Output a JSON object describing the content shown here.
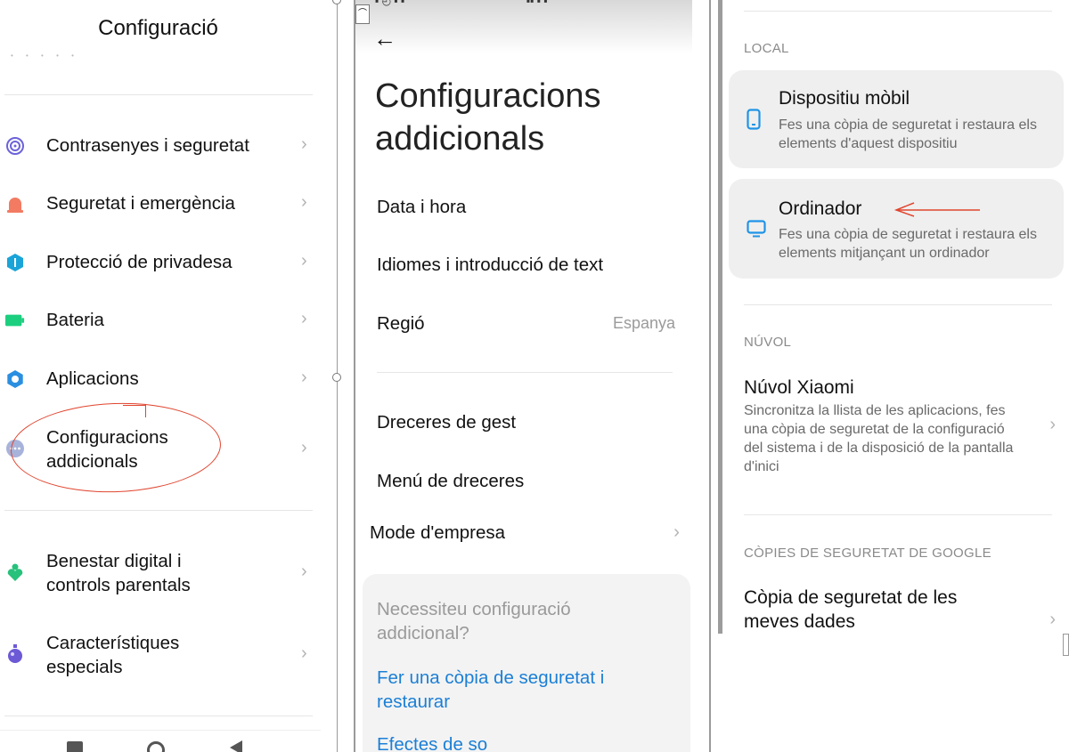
{
  "panel1": {
    "title": "Configuració",
    "items": [
      {
        "label": "Contrasenyes i seguretat",
        "icon": "fingerprint-icon",
        "color": "#6b63d9"
      },
      {
        "label": "Seguretat i emergència",
        "icon": "alarm-icon",
        "color": "#f27b62"
      },
      {
        "label": "Protecció de privadesa",
        "icon": "privacy-shield-icon",
        "color": "#1aa4d8"
      },
      {
        "label": "Bateria",
        "icon": "battery-icon",
        "color": "#1ccf7f"
      },
      {
        "label": "Aplicacions",
        "icon": "gear-icon",
        "color": "#2a8fe0"
      },
      {
        "label": "Configuracions addicionals",
        "icon": "more-dots-icon",
        "color": "#a7b3da"
      },
      {
        "label": "Benestar digital i controls parentals",
        "icon": "wellbeing-icon",
        "color": "#27c17b"
      },
      {
        "label": "Característiques especials",
        "icon": "special-features-icon",
        "color": "#6c59d6"
      }
    ]
  },
  "panel2": {
    "title": "Configuracions addicionals",
    "items": [
      {
        "label": "Data i hora",
        "value": ""
      },
      {
        "label": "Idiomes i introducció de text",
        "value": ""
      },
      {
        "label": "Regió",
        "value": "Espanya"
      },
      {
        "label": "Dreceres de gest",
        "value": ""
      },
      {
        "label": "Menú de dreceres",
        "value": ""
      },
      {
        "label": "Mode d'empresa",
        "value": ""
      }
    ],
    "help": {
      "title": "Necessiteu configuració addicional?",
      "links": [
        "Fer una còpia de seguretat i restaurar",
        "Efectes de so"
      ]
    }
  },
  "panel3": {
    "local_header": "LOCAL",
    "mobile": {
      "title": "Dispositiu mòbil",
      "sub": "Fes una còpia de seguretat i restaura els elements d'aquest dispositiu"
    },
    "computer": {
      "title": "Ordinador",
      "sub": "Fes una còpia de seguretat i restaura els elements mitjançant un ordinador"
    },
    "cloud_header": "NÚVOL",
    "xiaomi": {
      "title": "Núvol Xiaomi",
      "sub": "Sincronitza la llista de les aplicacions, fes una còpia de seguretat de la configuració del sistema i de la disposició de la pantalla d'inici"
    },
    "google_header": "CÒPIES DE SEGURETAT DE GOOGLE",
    "google_backup": {
      "title": "Còpia de seguretat de les meves dades"
    }
  },
  "colors": {
    "accent": "#1b7fd6",
    "annotation": "#e0452f",
    "icon_blue": "#1f93e6"
  }
}
